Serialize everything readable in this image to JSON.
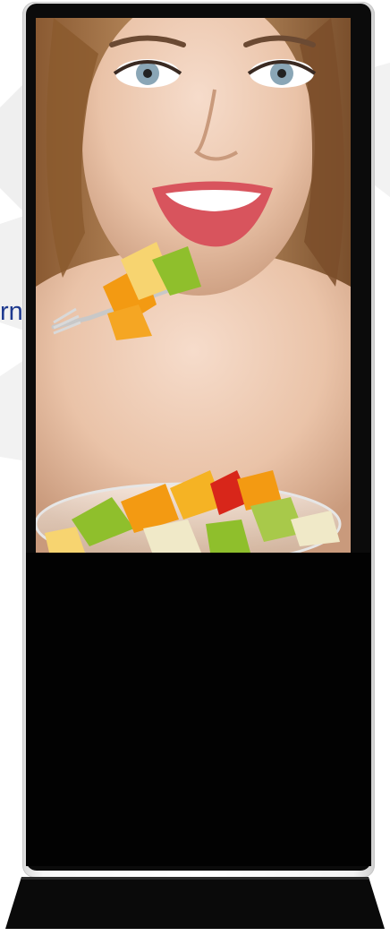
{
  "background": {
    "bleed_text": "rn",
    "text_color": "#1f3a8f"
  },
  "kiosk": {
    "frame_color": "#f2f2f2",
    "bezel_color": "#0b0b0b",
    "lower_panel_color": "#020202",
    "base_color": "#0a0a0a"
  },
  "screen_image": {
    "icon": "advertising-photo-woman-fruit-salad",
    "skin_color": "#e9c3a6",
    "hair_color": "#8a5a32",
    "lip_color": "#d8545d",
    "eye_color": "#8aa6b6",
    "fruit_colors": [
      "#f39a12",
      "#8fbf2c",
      "#d8261a",
      "#f7d470",
      "#f0e9c8"
    ]
  }
}
